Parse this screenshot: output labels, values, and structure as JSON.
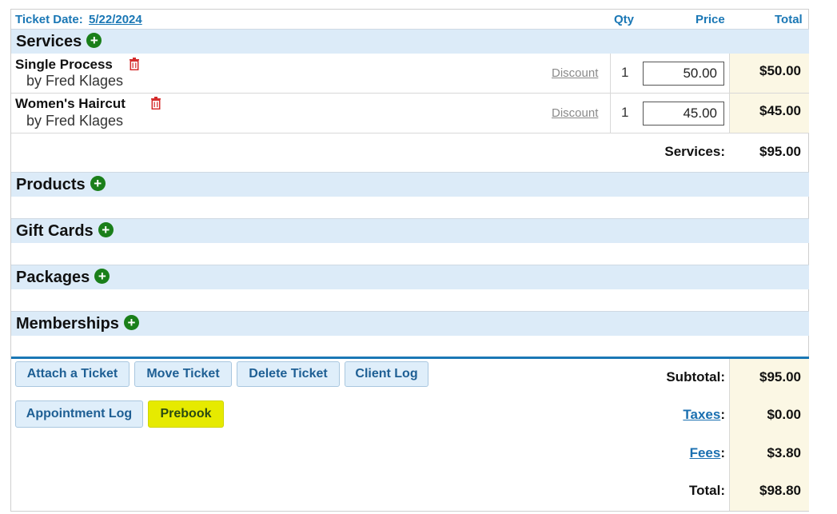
{
  "header": {
    "ticket_date_label": "Ticket Date:",
    "ticket_date": "5/22/2024",
    "qty_label": "Qty",
    "price_label": "Price",
    "total_label": "Total"
  },
  "services": {
    "title": "Services",
    "items": [
      {
        "name": "Single Process",
        "by": "by Fred Klages",
        "discount": "Discount",
        "qty": "1",
        "price": "50.00",
        "total": "$50.00"
      },
      {
        "name": "Women's Haircut",
        "by": "by Fred Klages",
        "discount": "Discount",
        "qty": "1",
        "price": "45.00",
        "total": "$45.00"
      }
    ],
    "subtotal_label": "Services:",
    "subtotal": "$95.00"
  },
  "sections": {
    "products": "Products",
    "gift_cards": "Gift Cards",
    "packages": "Packages",
    "memberships": "Memberships"
  },
  "actions": {
    "attach": "Attach a Ticket",
    "move": "Move Ticket",
    "delete": "Delete Ticket",
    "client_log": "Client Log",
    "appointment_log": "Appointment Log",
    "prebook": "Prebook"
  },
  "summary": {
    "subtotal_label": "Subtotal:",
    "subtotal": "$95.00",
    "taxes_label": "Taxes",
    "taxes": "$0.00",
    "fees_label": "Fees",
    "fees": "$3.80",
    "total_label": "Total:",
    "total": "$98.80"
  },
  "colors": {
    "accent": "#1a77b5",
    "section_bg": "#dcebf8",
    "total_col_bg": "#fbf7e4",
    "add_green": "#1a7f1a",
    "trash_red": "#d42a2a",
    "prebook_highlight": "#e6ea00"
  },
  "icons": {
    "add": "plus-circle-icon",
    "remove": "trash-icon"
  }
}
